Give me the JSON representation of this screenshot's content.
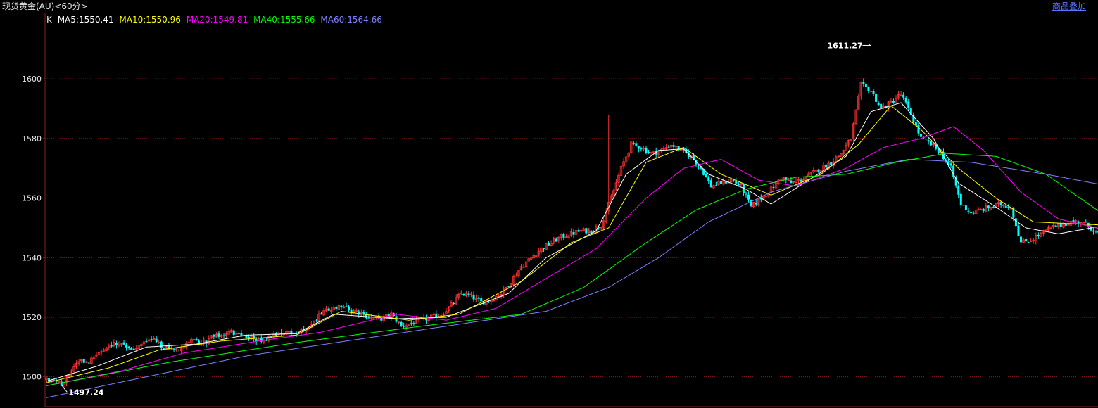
{
  "header": {
    "title": "现货黄金(AU)<60分>",
    "overlay_link": "商品叠加"
  },
  "legend": {
    "k_label": "K",
    "ma5": "MA5:1550.41",
    "ma10": "MA10:1550.96",
    "ma20": "MA20:1549.81",
    "ma40": "MA40:1555.66",
    "ma60": "MA60:1564.66"
  },
  "colors": {
    "background": "#000000",
    "up": "#ff3232",
    "down": "#00ffff",
    "grid": "#8c1e1e",
    "ma5": "#ffffff",
    "ma10": "#ffff00",
    "ma20": "#ff00ff",
    "ma40": "#00ff00",
    "ma60": "#8080ff"
  },
  "chart_data": {
    "type": "candlestick",
    "title": "现货黄金(AU)<60分>",
    "interval": "60分",
    "ylim": [
      1490,
      1622
    ],
    "y_ticks": [
      1500,
      1520,
      1540,
      1560,
      1580,
      1600
    ],
    "grid": true,
    "annotations": {
      "high": "1611.27",
      "low": "1497.24"
    },
    "ma_series": [
      {
        "name": "MA5",
        "value": 1550.41
      },
      {
        "name": "MA10",
        "value": 1550.96
      },
      {
        "name": "MA20",
        "value": 1549.81
      },
      {
        "name": "MA40",
        "value": 1555.66
      },
      {
        "name": "MA60",
        "value": 1564.66
      }
    ],
    "close_path": [
      [
        0,
        1499.0
      ],
      [
        4,
        1498.0
      ],
      [
        6,
        1497.6
      ],
      [
        8,
        1500.0
      ],
      [
        10,
        1502.5
      ],
      [
        14,
        1505.0
      ],
      [
        18,
        1505.5
      ],
      [
        22,
        1509.0
      ],
      [
        26,
        1511.0
      ],
      [
        30,
        1511.5
      ],
      [
        34,
        1509.5
      ],
      [
        38,
        1510.5
      ],
      [
        42,
        1513.0
      ],
      [
        46,
        1510.0
      ],
      [
        50,
        1509.0
      ],
      [
        54,
        1510.0
      ],
      [
        58,
        1512.0
      ],
      [
        62,
        1511.0
      ],
      [
        66,
        1513.0
      ],
      [
        70,
        1514.0
      ],
      [
        74,
        1515.0
      ],
      [
        78,
        1514.0
      ],
      [
        82,
        1513.0
      ],
      [
        86,
        1512.0
      ],
      [
        90,
        1514.0
      ],
      [
        94,
        1515.0
      ],
      [
        98,
        1514.5
      ],
      [
        102,
        1515.0
      ],
      [
        106,
        1518.0
      ],
      [
        110,
        1521.0
      ],
      [
        114,
        1523.0
      ],
      [
        118,
        1524.0
      ],
      [
        122,
        1522.0
      ],
      [
        126,
        1521.0
      ],
      [
        130,
        1520.0
      ],
      [
        134,
        1519.5
      ],
      [
        138,
        1521.0
      ],
      [
        142,
        1517.0
      ],
      [
        146,
        1518.0
      ],
      [
        150,
        1519.0
      ],
      [
        154,
        1520.0
      ],
      [
        158,
        1521.0
      ],
      [
        162,
        1524.0
      ],
      [
        166,
        1528.0
      ],
      [
        170,
        1527.0
      ],
      [
        174,
        1525.0
      ],
      [
        178,
        1526.0
      ],
      [
        182,
        1528.0
      ],
      [
        186,
        1532.0
      ],
      [
        190,
        1537.0
      ],
      [
        194,
        1540.0
      ],
      [
        198,
        1543.0
      ],
      [
        202,
        1545.0
      ],
      [
        206,
        1547.0
      ],
      [
        210,
        1548.0
      ],
      [
        214,
        1549.0
      ],
      [
        218,
        1549.0
      ],
      [
        222,
        1551.0
      ],
      [
        226,
        1560.0
      ],
      [
        230,
        1570.0
      ],
      [
        234,
        1578.0
      ],
      [
        238,
        1577.0
      ],
      [
        242,
        1575.0
      ],
      [
        246,
        1576.0
      ],
      [
        250,
        1578.0
      ],
      [
        254,
        1576.0
      ],
      [
        258,
        1574.0
      ],
      [
        262,
        1570.0
      ],
      [
        266,
        1564.0
      ],
      [
        270,
        1565.0
      ],
      [
        274,
        1566.0
      ],
      [
        278,
        1564.0
      ],
      [
        282,
        1557.0
      ],
      [
        286,
        1560.0
      ],
      [
        290,
        1563.0
      ],
      [
        294,
        1567.0
      ],
      [
        298,
        1565.0
      ],
      [
        302,
        1566.0
      ],
      [
        306,
        1568.0
      ],
      [
        310,
        1570.0
      ],
      [
        314,
        1572.0
      ],
      [
        318,
        1575.0
      ],
      [
        322,
        1580.0
      ],
      [
        326,
        1598.0
      ],
      [
        330,
        1596.0
      ],
      [
        334,
        1590.0
      ],
      [
        338,
        1592.0
      ],
      [
        342,
        1595.0
      ],
      [
        346,
        1588.0
      ],
      [
        350,
        1580.0
      ],
      [
        354,
        1578.0
      ],
      [
        358,
        1575.0
      ],
      [
        362,
        1570.0
      ],
      [
        366,
        1558.0
      ],
      [
        370,
        1555.0
      ],
      [
        374,
        1556.0
      ],
      [
        378,
        1557.0
      ],
      [
        382,
        1558.0
      ],
      [
        386,
        1557.0
      ],
      [
        390,
        1545.0
      ],
      [
        394,
        1546.0
      ],
      [
        398,
        1548.0
      ],
      [
        402,
        1550.0
      ],
      [
        406,
        1551.0
      ],
      [
        410,
        1552.0
      ],
      [
        414,
        1552.0
      ],
      [
        418,
        1550.0
      ],
      [
        421,
        1548.0
      ]
    ],
    "ma_paths": {
      "MA5": [
        [
          0,
          1498.5
        ],
        [
          20,
          1503.5
        ],
        [
          40,
          1510.0
        ],
        [
          60,
          1511.0
        ],
        [
          80,
          1514.0
        ],
        [
          100,
          1514.5
        ],
        [
          115,
          1521.0
        ],
        [
          140,
          1519.5
        ],
        [
          160,
          1520.0
        ],
        [
          185,
          1528.0
        ],
        [
          200,
          1540.0
        ],
        [
          220,
          1549.0
        ],
        [
          232,
          1568.0
        ],
        [
          245,
          1576.0
        ],
        [
          255,
          1576.5
        ],
        [
          265,
          1568.0
        ],
        [
          280,
          1563.0
        ],
        [
          290,
          1558.0
        ],
        [
          305,
          1566.0
        ],
        [
          320,
          1574.0
        ],
        [
          330,
          1589.0
        ],
        [
          342,
          1592.0
        ],
        [
          355,
          1580.0
        ],
        [
          365,
          1565.0
        ],
        [
          380,
          1557.0
        ],
        [
          392,
          1550.0
        ],
        [
          405,
          1548.0
        ],
        [
          421,
          1550.4
        ]
      ],
      "MA10": [
        [
          0,
          1498.0
        ],
        [
          25,
          1503.0
        ],
        [
          45,
          1509.0
        ],
        [
          70,
          1512.0
        ],
        [
          100,
          1514.0
        ],
        [
          118,
          1522.0
        ],
        [
          145,
          1519.0
        ],
        [
          165,
          1521.0
        ],
        [
          190,
          1532.0
        ],
        [
          210,
          1545.0
        ],
        [
          225,
          1550.0
        ],
        [
          240,
          1572.0
        ],
        [
          255,
          1577.0
        ],
        [
          270,
          1568.0
        ],
        [
          290,
          1561.0
        ],
        [
          310,
          1568.0
        ],
        [
          325,
          1578.0
        ],
        [
          338,
          1591.0
        ],
        [
          350,
          1583.0
        ],
        [
          365,
          1570.0
        ],
        [
          380,
          1560.0
        ],
        [
          395,
          1552.0
        ],
        [
          421,
          1551.0
        ]
      ],
      "MA20": [
        [
          0,
          1497.0
        ],
        [
          30,
          1502.0
        ],
        [
          55,
          1508.0
        ],
        [
          85,
          1512.0
        ],
        [
          110,
          1515.0
        ],
        [
          140,
          1521.0
        ],
        [
          160,
          1519.0
        ],
        [
          180,
          1523.0
        ],
        [
          200,
          1533.0
        ],
        [
          220,
          1543.0
        ],
        [
          240,
          1560.0
        ],
        [
          255,
          1570.0
        ],
        [
          270,
          1573.0
        ],
        [
          285,
          1566.0
        ],
        [
          300,
          1564.0
        ],
        [
          320,
          1570.0
        ],
        [
          335,
          1577.0
        ],
        [
          350,
          1580.0
        ],
        [
          363,
          1584.0
        ],
        [
          375,
          1576.0
        ],
        [
          390,
          1562.0
        ],
        [
          405,
          1553.0
        ],
        [
          421,
          1549.8
        ]
      ],
      "MA40": [
        [
          0,
          1497.0
        ],
        [
          50,
          1505.0
        ],
        [
          100,
          1511.5
        ],
        [
          150,
          1517.0
        ],
        [
          190,
          1521.0
        ],
        [
          215,
          1530.0
        ],
        [
          240,
          1545.0
        ],
        [
          260,
          1556.0
        ],
        [
          280,
          1563.0
        ],
        [
          300,
          1567.0
        ],
        [
          320,
          1568.0
        ],
        [
          340,
          1572.0
        ],
        [
          360,
          1575.0
        ],
        [
          380,
          1574.0
        ],
        [
          400,
          1568.0
        ],
        [
          421,
          1555.7
        ]
      ],
      "MA60": [
        [
          0,
          1493.0
        ],
        [
          40,
          1500.0
        ],
        [
          80,
          1507.0
        ],
        [
          120,
          1512.0
        ],
        [
          160,
          1517.0
        ],
        [
          200,
          1522.0
        ],
        [
          225,
          1530.0
        ],
        [
          245,
          1540.0
        ],
        [
          265,
          1552.0
        ],
        [
          290,
          1562.0
        ],
        [
          320,
          1569.0
        ],
        [
          345,
          1573.0
        ],
        [
          370,
          1572.0
        ],
        [
          400,
          1568.0
        ],
        [
          421,
          1564.7
        ]
      ]
    }
  }
}
